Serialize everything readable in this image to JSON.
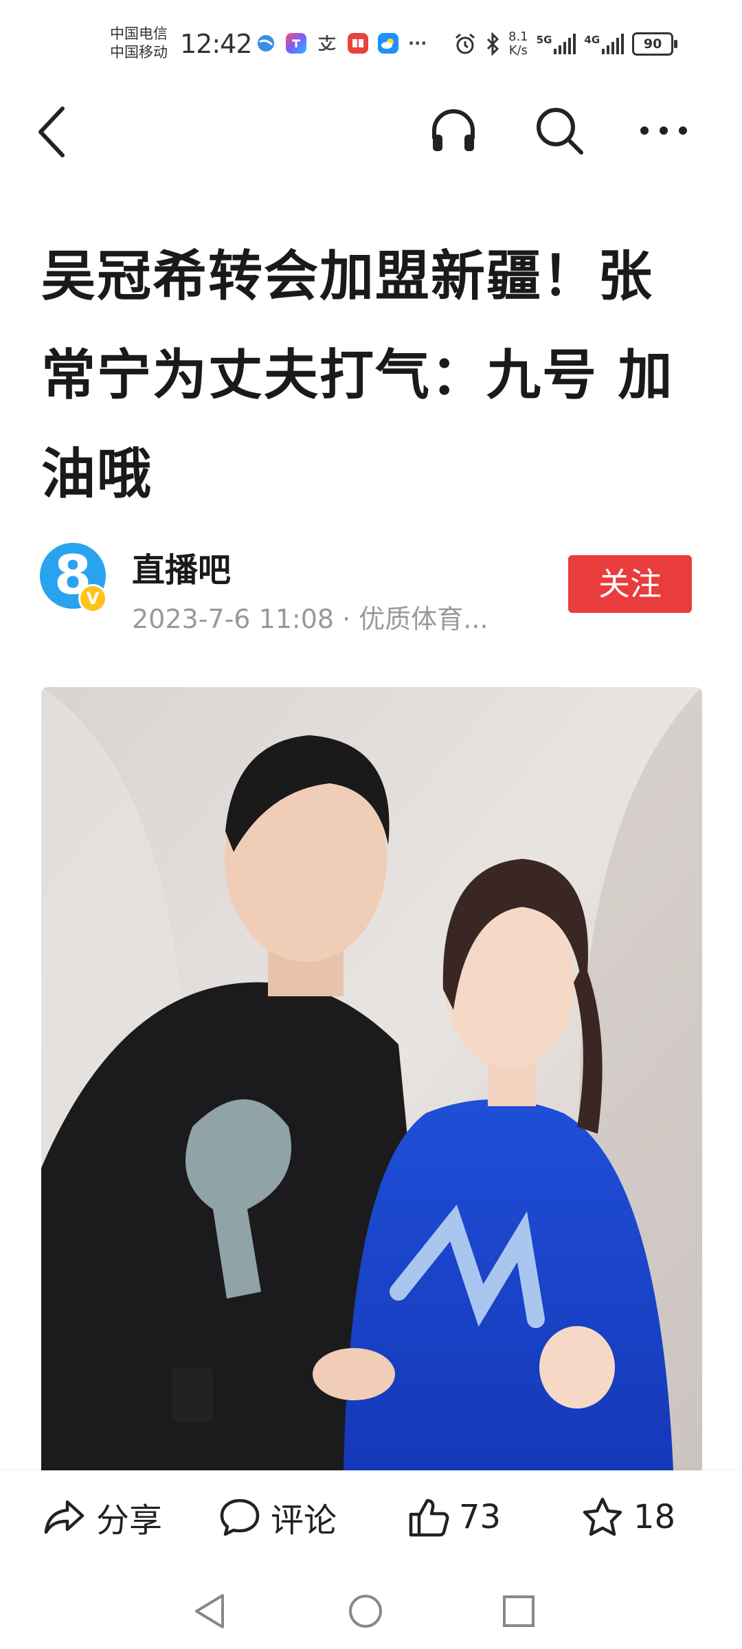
{
  "status_bar": {
    "carrier_1": "中国电信",
    "carrier_2": "中国移动",
    "time": "12:42",
    "net_speed_value": "8.1",
    "net_speed_unit": "K/s",
    "net_1": "5G",
    "net_2": "4G",
    "battery": "90",
    "more": "···"
  },
  "article": {
    "title": "吴冠希转会加盟新疆！张常宁为丈夫打气：九号 加油哦",
    "author": "直播吧",
    "avatar_text": "8",
    "verified_badge": "V",
    "meta": "2023-7-6 11:08 · 优质体育...",
    "follow_label": "关注"
  },
  "bottom_bar": {
    "share_label": "分享",
    "comment_label": "评论",
    "like_count": "73",
    "favorite_count": "18"
  },
  "colors": {
    "accent": "#e93c3c",
    "avatar": "#2aa3ee",
    "badge": "#ffc21a",
    "meta_text": "#999999"
  }
}
